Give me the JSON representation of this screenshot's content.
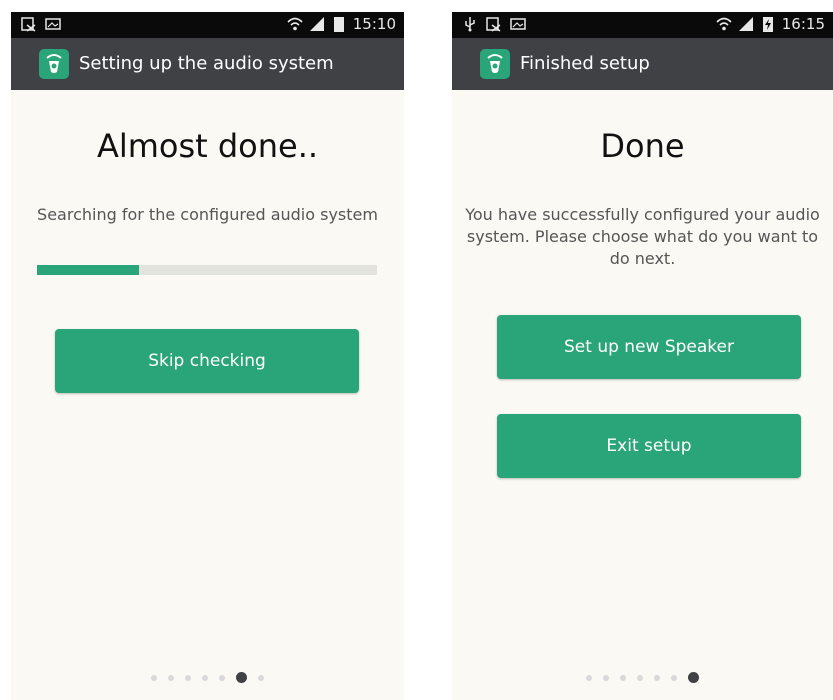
{
  "left_screen": {
    "status_bar": {
      "icons": [
        "notification-icon",
        "image-icon",
        "wifi-icon",
        "signal-icon",
        "battery-icon"
      ],
      "time": "15:10"
    },
    "action_bar": {
      "title": "Setting up the audio system"
    },
    "heading": "Almost done..",
    "message": "Searching for the configured audio system",
    "progress_fraction": 0.3,
    "skip_button_label": "Skip checking",
    "page_dots": {
      "count": 7,
      "active_index": 5
    }
  },
  "right_screen": {
    "status_bar": {
      "icons": [
        "usb-icon",
        "notification-icon",
        "image-icon",
        "wifi-icon",
        "signal-icon",
        "battery-charging-icon"
      ],
      "time": "16:15"
    },
    "action_bar": {
      "title": "Finished setup"
    },
    "heading": "Done",
    "message": "You have successfully configured your audio system. Please choose what do you want to do next.",
    "new_speaker_button_label": "Set up new Speaker",
    "exit_button_label": "Exit setup",
    "page_dots": {
      "count": 7,
      "active_index": 6
    }
  },
  "colors": {
    "accent": "#2aa579",
    "action_bar": "#3f4144",
    "status_bar": "#0a0a0a",
    "screen_background": "#fbf9f3"
  }
}
